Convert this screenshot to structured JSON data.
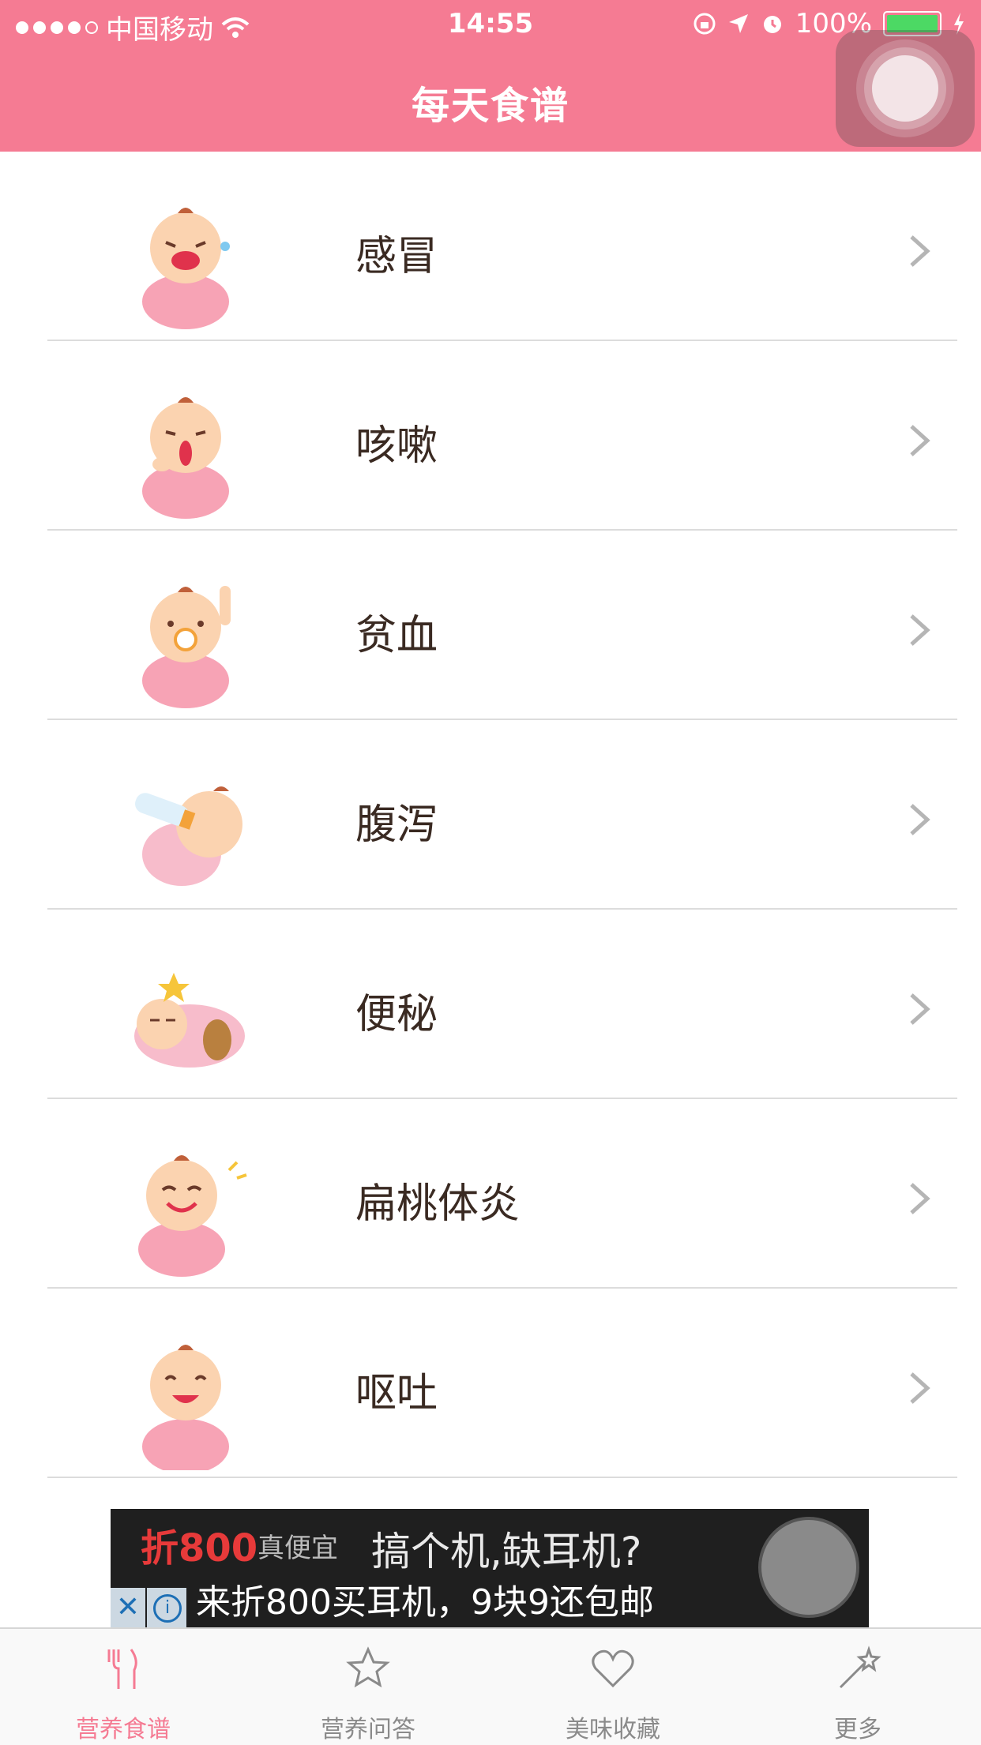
{
  "status_bar": {
    "carrier": "中国移动",
    "time": "14:55",
    "battery": "100%",
    "signal_filled": 4,
    "signal_total": 5
  },
  "header": {
    "title": "每天食谱",
    "background": "#f57b93"
  },
  "list": {
    "items": [
      {
        "label": "感冒",
        "icon": "baby-crying-icon"
      },
      {
        "label": "咳嗽",
        "icon": "baby-coughing-icon"
      },
      {
        "label": "贫血",
        "icon": "baby-pacifier-icon"
      },
      {
        "label": "腹泻",
        "icon": "baby-bottle-icon"
      },
      {
        "label": "便秘",
        "icon": "baby-sleeping-icon"
      },
      {
        "label": "扁桃体炎",
        "icon": "baby-pointing-icon"
      },
      {
        "label": "呕吐",
        "icon": "baby-smiling-icon"
      }
    ]
  },
  "ad": {
    "brand": "折800",
    "brand_tagline": "真便宜",
    "headline": "搞个机,缺耳机?",
    "subline": "来折800买耳机，9块9还包邮"
  },
  "tabbar": {
    "tabs": [
      {
        "label": "营养食谱",
        "icon": "fork-knife-icon",
        "active": true
      },
      {
        "label": "营养问答",
        "icon": "star-icon",
        "active": false
      },
      {
        "label": "美味收藏",
        "icon": "heart-icon",
        "active": false
      },
      {
        "label": "更多",
        "icon": "magic-wand-icon",
        "active": false
      }
    ],
    "active_color": "#f57b93",
    "inactive_color": "#8a8a8a"
  }
}
